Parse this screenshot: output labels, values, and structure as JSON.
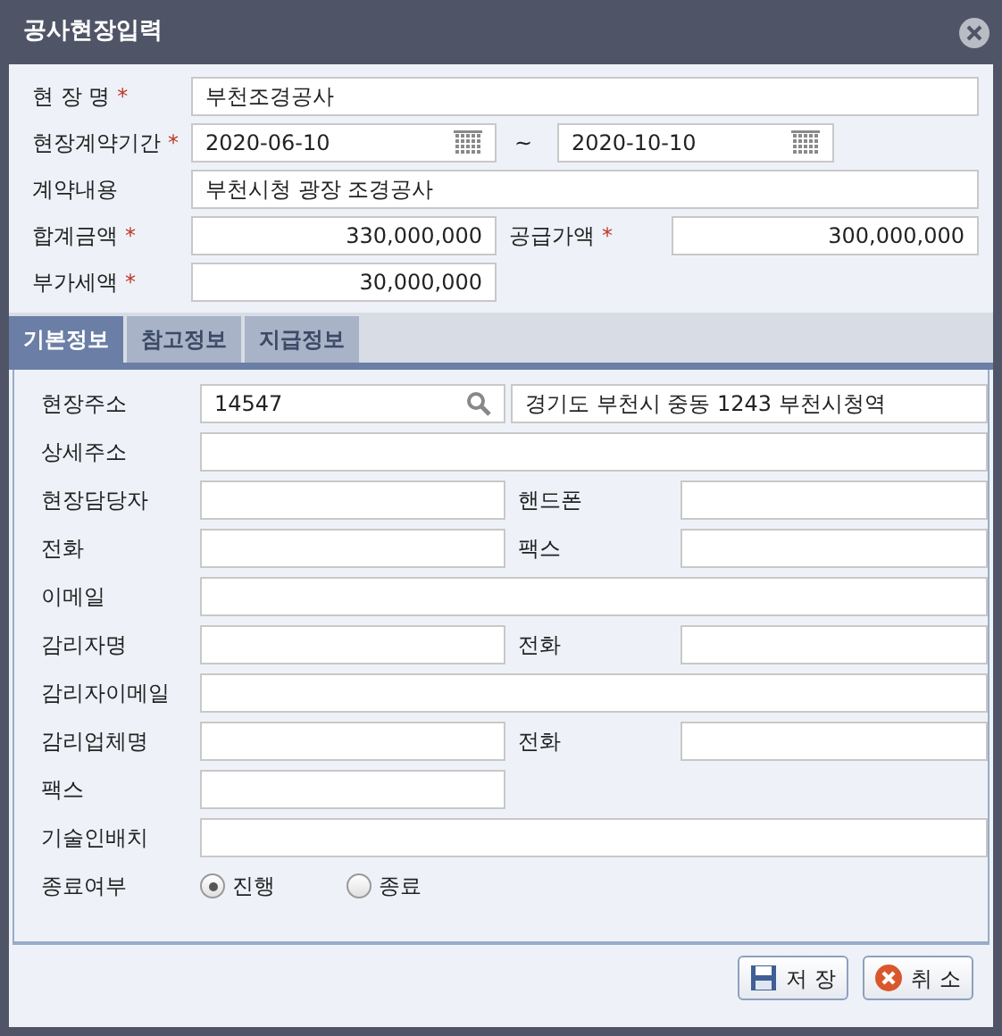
{
  "window": {
    "title": "공사현장입력"
  },
  "header_rows": [
    {
      "kind": "full",
      "fields": [
        {
          "label": "현 장 명",
          "mark": "*",
          "value": "부천조경공사",
          "numeric": false
        }
      ]
    },
    {
      "kind": "date_range",
      "fields": [
        {
          "label": "현장계약기간",
          "mark": "*",
          "value": "2020-06-10",
          "numeric": false
        },
        {
          "separator": "~",
          "value": "2020-10-10",
          "numeric": false
        }
      ]
    },
    {
      "kind": "full",
      "fields": [
        {
          "label": "계약내용",
          "value": "부천시청 광장 조경공사",
          "numeric": false
        }
      ]
    },
    {
      "kind": "pair",
      "fields": [
        {
          "label": "합계금액",
          "mark": "*",
          "value": "330,000,000",
          "numeric": true
        },
        {
          "label": "공급가액",
          "mark": "*",
          "value": "300,000,000",
          "numeric": true
        }
      ]
    },
    {
      "kind": "single",
      "fields": [
        {
          "label": "부가세액",
          "mark": "*",
          "value": "30,000,000",
          "numeric": true
        }
      ]
    }
  ],
  "tabs": [
    {
      "label": "기본정보",
      "selected": true
    },
    {
      "label": "참고정보",
      "selected": false
    },
    {
      "label": "지급정보",
      "selected": false
    }
  ],
  "tab_rows": [
    {
      "kind": "address",
      "fields": [
        {
          "label": "현장주소",
          "value": "14547"
        },
        {
          "value": "경기도 부천시 중동 1243 부천시청역"
        }
      ]
    },
    {
      "kind": "full",
      "fields": [
        {
          "label": "상세주소"
        }
      ]
    },
    {
      "kind": "pair",
      "fields": [
        {
          "label": "현장담당자"
        },
        {
          "label": "핸드폰"
        }
      ]
    },
    {
      "kind": "pair",
      "fields": [
        {
          "label": "전화"
        },
        {
          "label": "팩스"
        }
      ]
    },
    {
      "kind": "full",
      "fields": [
        {
          "label": "이메일"
        }
      ]
    },
    {
      "kind": "pair",
      "fields": [
        {
          "label": "감리자명"
        },
        {
          "label": "전화"
        }
      ]
    },
    {
      "kind": "full",
      "fields": [
        {
          "label": "감리자이메일"
        }
      ]
    },
    {
      "kind": "pair",
      "fields": [
        {
          "label": "감리업체명"
        },
        {
          "label": "전화"
        }
      ]
    },
    {
      "kind": "single",
      "fields": [
        {
          "label": "팩스"
        }
      ]
    },
    {
      "kind": "full",
      "fields": [
        {
          "label": "기술인배치"
        }
      ]
    },
    {
      "kind": "radio",
      "label": "종료여부",
      "options": [
        {
          "label": "진행",
          "selected": true
        },
        {
          "label": "종료",
          "selected": false
        }
      ]
    }
  ],
  "buttons": [
    {
      "kind": "save",
      "label": "저 장"
    },
    {
      "kind": "cancel",
      "label": "취 소"
    }
  ]
}
